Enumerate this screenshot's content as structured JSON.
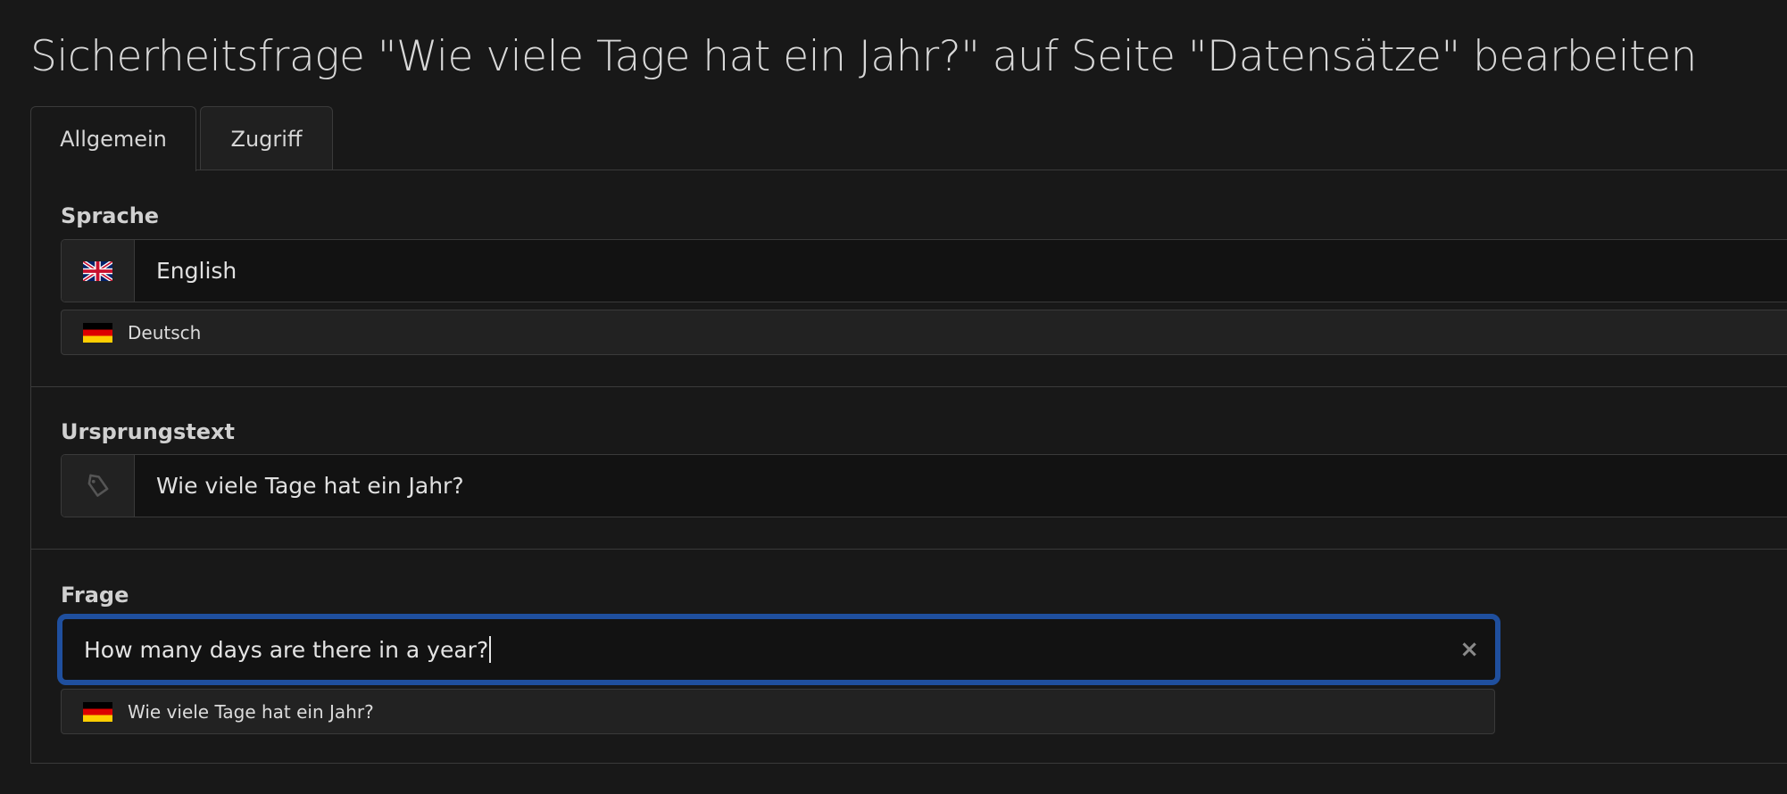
{
  "page": {
    "title": "Sicherheitsfrage \"Wie viele Tage hat ein Jahr?\" auf Seite \"Datensätze\" bearbeiten"
  },
  "tabs": [
    {
      "label": "Allgemein",
      "active": true
    },
    {
      "label": "Zugriff",
      "active": false
    }
  ],
  "fields": {
    "language": {
      "label": "Sprache",
      "value": "English",
      "icon": "uk-flag-icon",
      "hint_icon": "german-flag-icon",
      "hint": "Deutsch"
    },
    "source_text": {
      "label": "Ursprungstext",
      "value": "Wie viele Tage hat ein Jahr?",
      "icon": "tag-icon"
    },
    "question": {
      "label": "Frage",
      "value": "How many days are there in a year?",
      "clear_icon": "×",
      "hint_icon": "german-flag-icon",
      "hint": "Wie viele Tage hat ein Jahr?"
    }
  },
  "colors": {
    "background": "#181818",
    "focus_border": "#1f4f9e"
  }
}
